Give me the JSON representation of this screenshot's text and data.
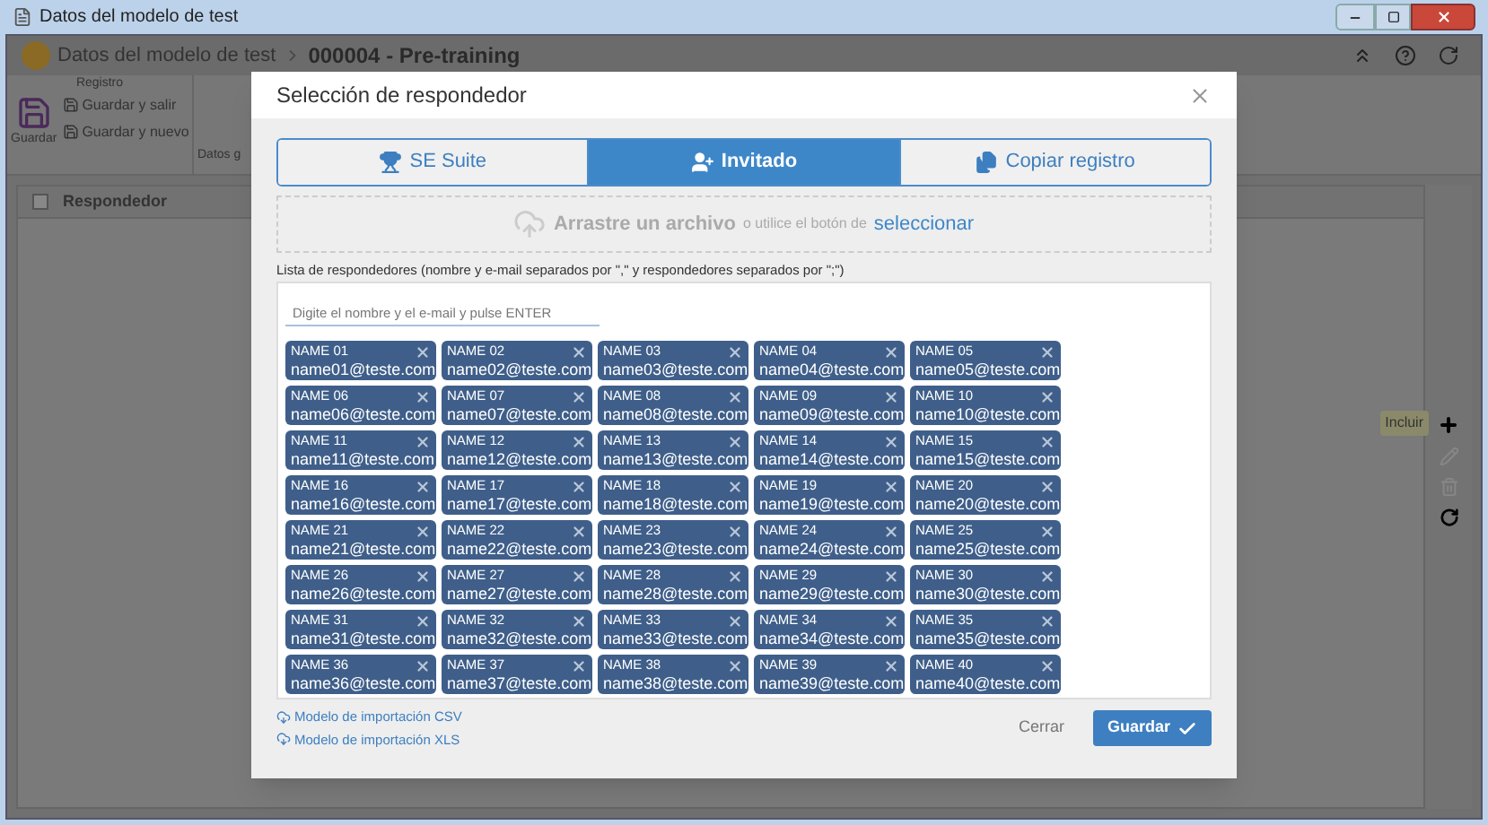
{
  "window": {
    "title": "Datos del modelo de test"
  },
  "header": {
    "breadcrumb": "Datos del modelo de test",
    "record": "000004 - Pre-training"
  },
  "ribbon": {
    "group": "Registro",
    "save": "Guardar",
    "save_exit": "Guardar y salir",
    "save_new": "Guardar y nuevo",
    "data": "Datos g"
  },
  "grid": {
    "checked": false,
    "column": "Respondedor",
    "tooltip": "Incluir"
  },
  "dialog": {
    "title": "Selección de respondedor",
    "tabs": [
      {
        "label": "SE Suite",
        "kind": "trophy",
        "selected": false
      },
      {
        "label": "Invitado",
        "kind": "users",
        "selected": true
      },
      {
        "label": "Copiar registro",
        "kind": "copy",
        "selected": false
      }
    ],
    "drop": {
      "main": "Arrastre un archivo",
      "middle": "o utilice el botón de",
      "link": "seleccionar"
    },
    "list_label": "Lista de respondedores (nombre y e-mail separados por \",\" y respondedores separados por \";\")",
    "input": {
      "placeholder": "Digite el nombre y el e-mail y pulse ENTER"
    },
    "chips": [
      {
        "name": "NAME 01",
        "email": "name01@teste.com"
      },
      {
        "name": "NAME 02",
        "email": "name02@teste.com"
      },
      {
        "name": "NAME 03",
        "email": "name03@teste.com"
      },
      {
        "name": "NAME 04",
        "email": "name04@teste.com"
      },
      {
        "name": "NAME 05",
        "email": "name05@teste.com"
      },
      {
        "name": "NAME 06",
        "email": "name06@teste.com"
      },
      {
        "name": "NAME 07",
        "email": "name07@teste.com"
      },
      {
        "name": "NAME 08",
        "email": "name08@teste.com"
      },
      {
        "name": "NAME 09",
        "email": "name09@teste.com"
      },
      {
        "name": "NAME 10",
        "email": "name10@teste.com"
      },
      {
        "name": "NAME 11",
        "email": "name11@teste.com"
      },
      {
        "name": "NAME 12",
        "email": "name12@teste.com"
      },
      {
        "name": "NAME 13",
        "email": "name13@teste.com"
      },
      {
        "name": "NAME 14",
        "email": "name14@teste.com"
      },
      {
        "name": "NAME 15",
        "email": "name15@teste.com"
      },
      {
        "name": "NAME 16",
        "email": "name16@teste.com"
      },
      {
        "name": "NAME 17",
        "email": "name17@teste.com"
      },
      {
        "name": "NAME 18",
        "email": "name18@teste.com"
      },
      {
        "name": "NAME 19",
        "email": "name19@teste.com"
      },
      {
        "name": "NAME 20",
        "email": "name20@teste.com"
      },
      {
        "name": "NAME 21",
        "email": "name21@teste.com"
      },
      {
        "name": "NAME 22",
        "email": "name22@teste.com"
      },
      {
        "name": "NAME 23",
        "email": "name23@teste.com"
      },
      {
        "name": "NAME 24",
        "email": "name24@teste.com"
      },
      {
        "name": "NAME 25",
        "email": "name25@teste.com"
      },
      {
        "name": "NAME 26",
        "email": "name26@teste.com"
      },
      {
        "name": "NAME 27",
        "email": "name27@teste.com"
      },
      {
        "name": "NAME 28",
        "email": "name28@teste.com"
      },
      {
        "name": "NAME 29",
        "email": "name29@teste.com"
      },
      {
        "name": "NAME 30",
        "email": "name30@teste.com"
      },
      {
        "name": "NAME 31",
        "email": "name31@teste.com"
      },
      {
        "name": "NAME 32",
        "email": "name32@teste.com"
      },
      {
        "name": "NAME 33",
        "email": "name33@teste.com"
      },
      {
        "name": "NAME 34",
        "email": "name34@teste.com"
      },
      {
        "name": "NAME 35",
        "email": "name35@teste.com"
      },
      {
        "name": "NAME 36",
        "email": "name36@teste.com"
      },
      {
        "name": "NAME 37",
        "email": "name37@teste.com"
      },
      {
        "name": "NAME 38",
        "email": "name38@teste.com"
      },
      {
        "name": "NAME 39",
        "email": "name39@teste.com"
      },
      {
        "name": "NAME 40",
        "email": "name40@teste.com"
      }
    ],
    "links": [
      "Modelo de importación CSV",
      "Modelo de importación XLS"
    ],
    "close": "Cerrar",
    "save": "Guardar"
  }
}
